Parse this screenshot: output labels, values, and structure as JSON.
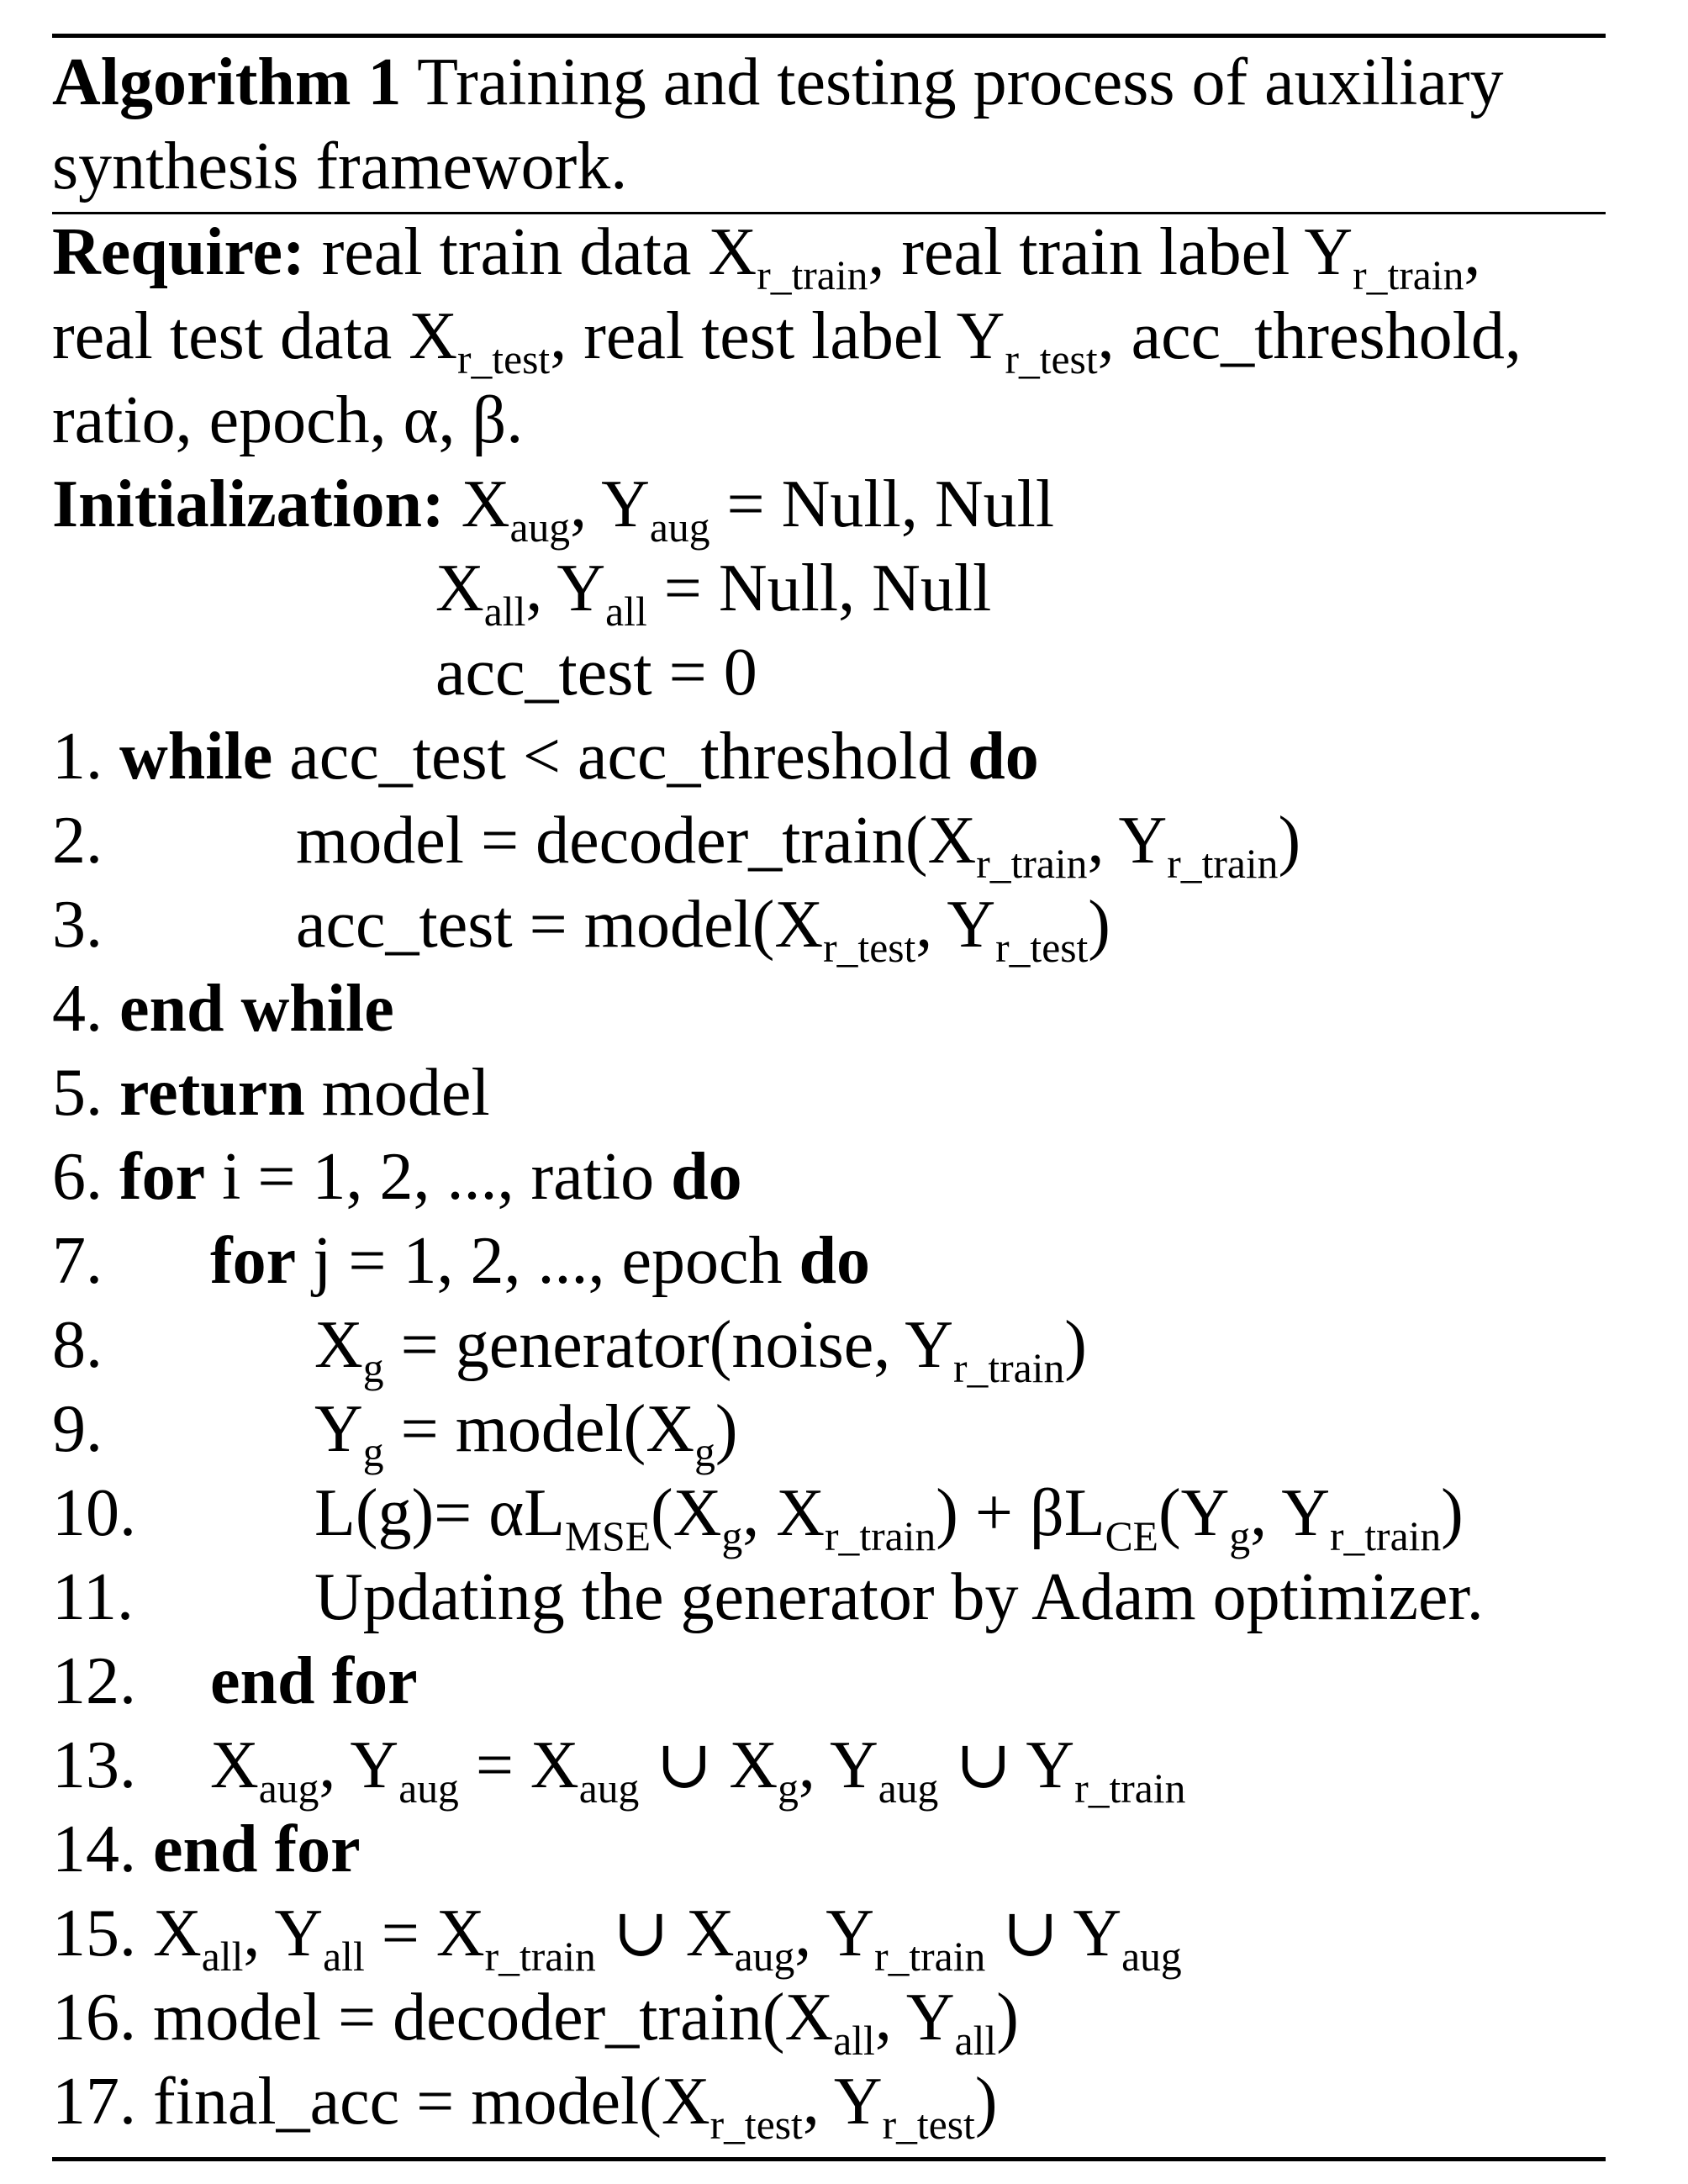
{
  "title": {
    "label": "Algorithm 1",
    "text_line1": "Training and testing  process of auxiliary",
    "text_line2": "synthesis framework."
  },
  "require": {
    "label": "Require:",
    "line1": [
      "real train data X",
      "r_train",
      ", real train label Y",
      "r_train",
      ","
    ],
    "line2": [
      "real test data X",
      "r_test",
      ", real test label Y",
      "r_test",
      ", acc_threshold,"
    ],
    "line3": "ratio, epoch, α, β."
  },
  "initialization": {
    "label": "Initialization:",
    "line1": [
      "X",
      "aug",
      ", Y",
      "aug",
      " = Null, Null"
    ],
    "line2": [
      "X",
      "all",
      ", Y",
      "all",
      " = Null, Null"
    ],
    "line3": "acc_test = 0"
  },
  "steps": {
    "s1": {
      "num": "1.",
      "kw1": "while",
      "text": " acc_test < acc_threshold ",
      "kw2": "do"
    },
    "s2": {
      "num": "2.",
      "parts": [
        "model = decoder_train(X",
        "r_train",
        ", Y",
        "r_train",
        ")"
      ]
    },
    "s3": {
      "num": "3.",
      "parts": [
        "acc_test = model(X",
        "r_test",
        ", Y",
        "r_test",
        ")"
      ]
    },
    "s4": {
      "num": "4.",
      "kw": "end while"
    },
    "s5": {
      "num": "5.",
      "kw": "return",
      "text": " model"
    },
    "s6": {
      "num": "6.",
      "kw1": "for",
      "text": " i = 1, 2, ..., ratio ",
      "kw2": "do"
    },
    "s7": {
      "num": "7.",
      "kw1": "for",
      "text": " j = 1, 2, ..., epoch ",
      "kw2": "do"
    },
    "s8": {
      "num": "8.",
      "parts": [
        "X",
        "g",
        " = generator(noise, Y",
        "r_train",
        ")"
      ]
    },
    "s9": {
      "num": "9.",
      "parts": [
        "Y",
        "g",
        " = model(X",
        "g",
        ")"
      ]
    },
    "s10": {
      "num": "10.",
      "parts": [
        "L(g)= αL",
        "MSE",
        "(X",
        "g",
        ", X",
        "r_train",
        ") + βL",
        "CE",
        "(Y",
        "g",
        ", Y",
        "r_train",
        ")"
      ]
    },
    "s11": {
      "num": "11.",
      "text": "Updating the generator by Adam optimizer."
    },
    "s12": {
      "num": "12.",
      "kw": "end for"
    },
    "s13": {
      "num": "13.",
      "parts": [
        "X",
        "aug",
        ", Y",
        "aug",
        " = X",
        "aug",
        " ∪ X",
        "g",
        ", Y",
        "aug",
        " ∪ Y",
        "r_train"
      ]
    },
    "s14": {
      "num": "14.",
      "kw": "end for"
    },
    "s15": {
      "num": "15.",
      "parts": [
        "X",
        "all",
        ", Y",
        "all",
        " = X",
        "r_train",
        " ∪ X",
        "aug",
        ", Y",
        "r_train",
        " ∪ Y",
        "aug"
      ]
    },
    "s16": {
      "num": "16.",
      "parts": [
        "model = decoder_train(X",
        "all",
        ", Y",
        "all",
        ")"
      ]
    },
    "s17": {
      "num": "17.",
      "parts": [
        "final_acc = model(X",
        "r_test",
        ", Y",
        "r_test",
        ")"
      ]
    }
  }
}
